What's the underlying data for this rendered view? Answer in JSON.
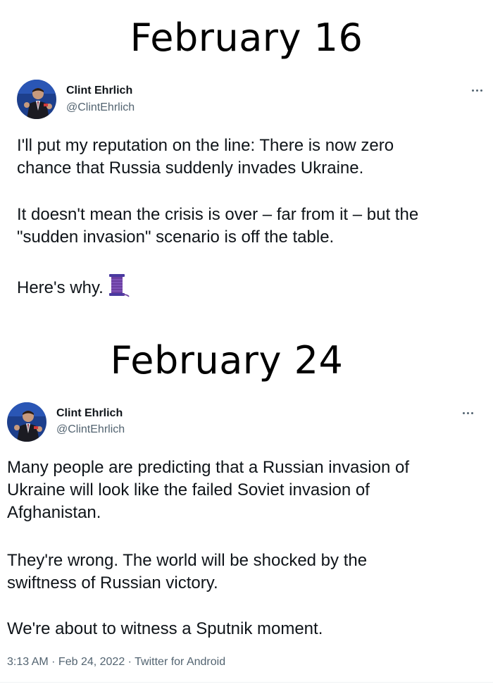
{
  "headings": {
    "first": "February 16",
    "second": "February 24"
  },
  "tweet1": {
    "name": "Clint Ehrlich",
    "handle": "@ClintEhrlich",
    "paragraphs": [
      "I'll put my reputation on the line: There is now zero\nchance that Russia suddenly invades Ukraine.",
      "It doesn't mean the crisis is over – far from it – but the\n\"sudden invasion\" scenario is off the table.",
      "Here's why."
    ],
    "emoji_icon": "thread-spool-icon"
  },
  "tweet2": {
    "name": "Clint Ehrlich",
    "handle": "@ClintEhrlich",
    "paragraphs": [
      "Many people are predicting that a Russian invasion of\nUkraine will look like the failed Soviet invasion of\nAfghanistan.",
      "They're wrong. The world will be shocked by the\nswiftness of Russian victory.",
      "We're about to witness a Sputnik moment."
    ],
    "timestamp": "3:13 AM · Feb 24, 2022 · Twitter for Android"
  },
  "colors": {
    "text": "#0f1419",
    "secondary": "#536471",
    "spool": "#6b3fa0"
  }
}
